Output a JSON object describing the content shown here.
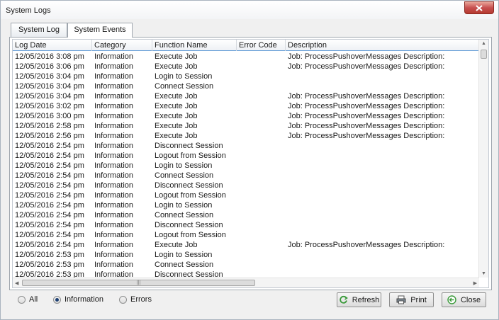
{
  "window": {
    "title": "System Logs"
  },
  "tabs": [
    {
      "label": "System Log"
    },
    {
      "label": "System Events"
    }
  ],
  "grid": {
    "columns": [
      "Log Date",
      "Category",
      "Function Name",
      "Error Code",
      "Description"
    ],
    "rows": [
      [
        "12/05/2016 3:08 pm",
        "Information",
        "Execute Job",
        "",
        "Job: ProcessPushoverMessages Description:"
      ],
      [
        "12/05/2016 3:06 pm",
        "Information",
        "Execute Job",
        "",
        "Job: ProcessPushoverMessages Description:"
      ],
      [
        "12/05/2016 3:04 pm",
        "Information",
        "Login to Session",
        "",
        ""
      ],
      [
        "12/05/2016 3:04 pm",
        "Information",
        "Connect Session",
        "",
        ""
      ],
      [
        "12/05/2016 3:04 pm",
        "Information",
        "Execute Job",
        "",
        "Job: ProcessPushoverMessages Description:"
      ],
      [
        "12/05/2016 3:02 pm",
        "Information",
        "Execute Job",
        "",
        "Job: ProcessPushoverMessages Description:"
      ],
      [
        "12/05/2016 3:00 pm",
        "Information",
        "Execute Job",
        "",
        "Job: ProcessPushoverMessages Description:"
      ],
      [
        "12/05/2016 2:58 pm",
        "Information",
        "Execute Job",
        "",
        "Job: ProcessPushoverMessages Description:"
      ],
      [
        "12/05/2016 2:56 pm",
        "Information",
        "Execute Job",
        "",
        "Job: ProcessPushoverMessages Description:"
      ],
      [
        "12/05/2016 2:54 pm",
        "Information",
        "Disconnect Session",
        "",
        ""
      ],
      [
        "12/05/2016 2:54 pm",
        "Information",
        "Logout from Session",
        "",
        ""
      ],
      [
        "12/05/2016 2:54 pm",
        "Information",
        "Login to Session",
        "",
        ""
      ],
      [
        "12/05/2016 2:54 pm",
        "Information",
        "Connect Session",
        "",
        ""
      ],
      [
        "12/05/2016 2:54 pm",
        "Information",
        "Disconnect Session",
        "",
        ""
      ],
      [
        "12/05/2016 2:54 pm",
        "Information",
        "Logout from Session",
        "",
        ""
      ],
      [
        "12/05/2016 2:54 pm",
        "Information",
        "Login to Session",
        "",
        ""
      ],
      [
        "12/05/2016 2:54 pm",
        "Information",
        "Connect Session",
        "",
        ""
      ],
      [
        "12/05/2016 2:54 pm",
        "Information",
        "Disconnect Session",
        "",
        ""
      ],
      [
        "12/05/2016 2:54 pm",
        "Information",
        "Logout from Session",
        "",
        ""
      ],
      [
        "12/05/2016 2:54 pm",
        "Information",
        "Execute Job",
        "",
        "Job: ProcessPushoverMessages Description:"
      ],
      [
        "12/05/2016 2:53 pm",
        "Information",
        "Login to Session",
        "",
        ""
      ],
      [
        "12/05/2016 2:53 pm",
        "Information",
        "Connect Session",
        "",
        ""
      ],
      [
        "12/05/2016 2:53 pm",
        "Information",
        "Disconnect Session",
        "",
        ""
      ]
    ]
  },
  "filters": {
    "options": [
      {
        "label": "All",
        "selected": false
      },
      {
        "label": "Information",
        "selected": true
      },
      {
        "label": "Errors",
        "selected": false
      }
    ]
  },
  "buttons": {
    "refresh": "Refresh",
    "print": "Print",
    "close": "Close"
  },
  "colors": {
    "accent": "#6aa0d8",
    "close_red": "#c75050",
    "refresh_green": "#3a9a3a"
  }
}
